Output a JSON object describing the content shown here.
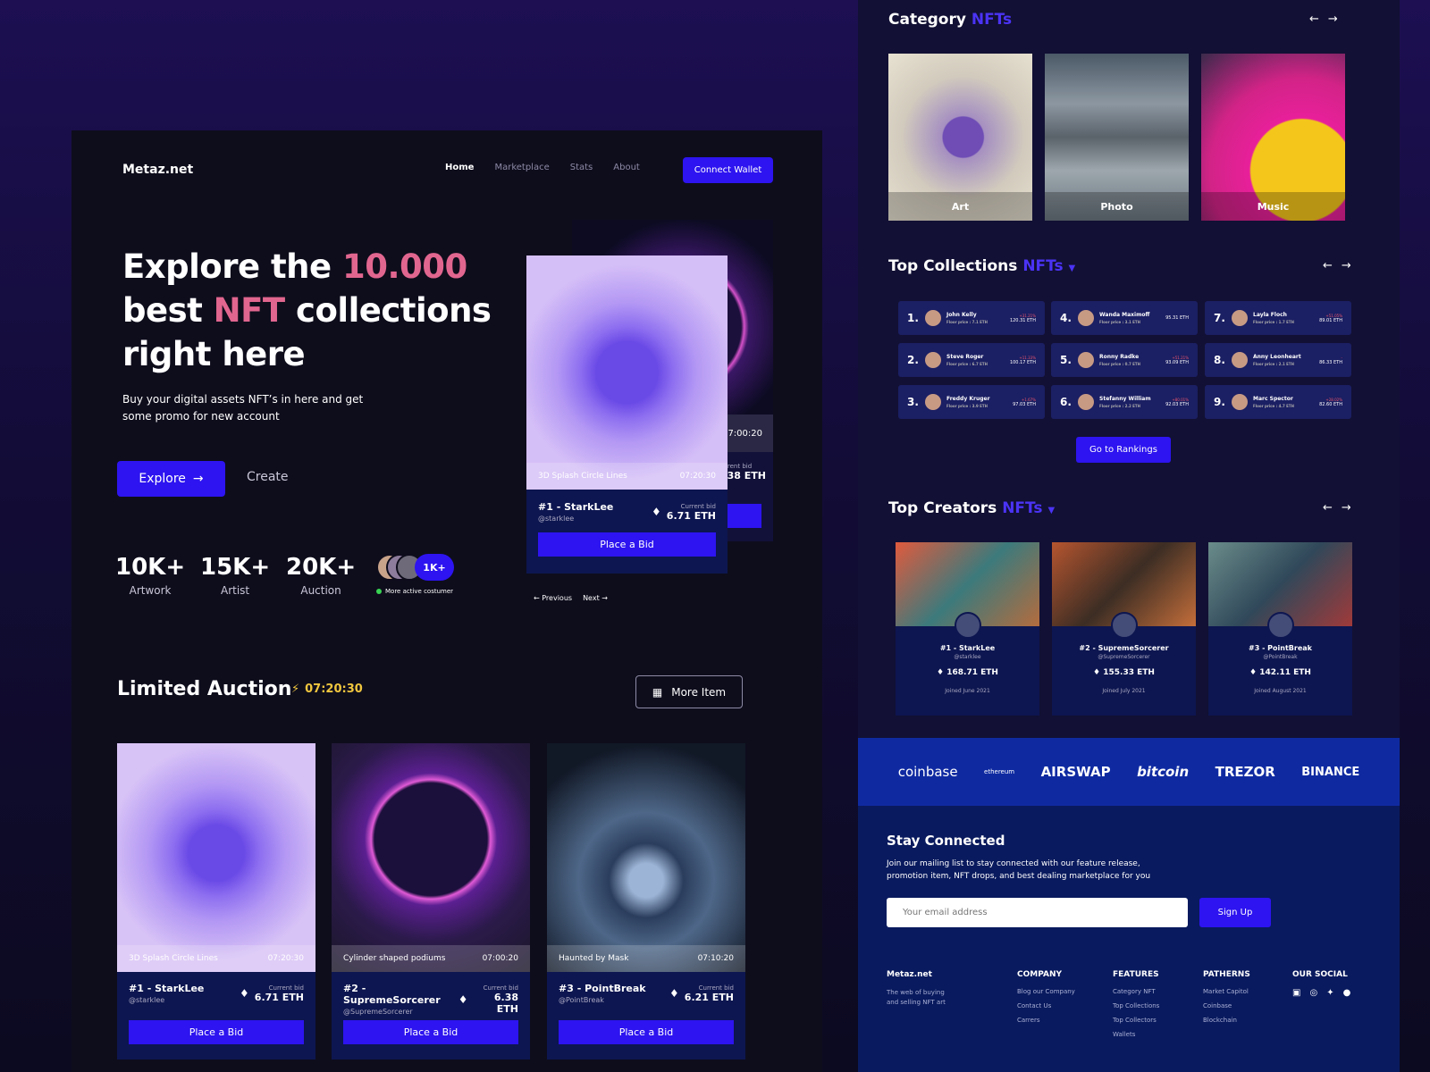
{
  "header": {
    "logo": "Metaz.net",
    "nav": [
      "Home",
      "Marketplace",
      "Stats",
      "About"
    ],
    "connect_label": "Connect Wallet"
  },
  "hero": {
    "title_pre": "Explore the ",
    "title_hl1": "10.000",
    "title_mid": "best ",
    "title_hl2": "NFT",
    "title_post": " collections right here",
    "subtitle": "Buy your digital assets NFT’s in here and get some promo for new account",
    "explore_label": "Explore",
    "create_label": "Create",
    "stats": [
      {
        "num": "10K+",
        "label": "Artwork"
      },
      {
        "num": "15K+",
        "label": "Artist"
      },
      {
        "num": "20K+",
        "label": "Auction"
      }
    ],
    "avatar_badge": "1K+",
    "active_label": "More active costumer",
    "back_card": {
      "timer": "07:00:20",
      "bid_label": "Current bid",
      "bid_value": "6.38 ETH"
    },
    "front_card": {
      "name": "3D Splash Circle Lines",
      "timer": "07:20:30",
      "title": "#1 - StarkLee",
      "handle": "@starklee",
      "bid_label": "Current bid",
      "bid_value": "6.71 ETH",
      "button": "Place a Bid"
    },
    "prev_label": "Previous",
    "next_label": "Next"
  },
  "auction": {
    "title": "Limited Auction",
    "timer": "07:20:30",
    "more_label": "More Item",
    "items": [
      {
        "name": "3D Splash Circle Lines",
        "timer": "07:20:30",
        "title": "#1 - StarkLee",
        "handle": "@starklee",
        "bid_label": "Current bid",
        "bid_value": "6.71 ETH",
        "button": "Place a Bid"
      },
      {
        "name": "Cylinder shaped podiums",
        "timer": "07:00:20",
        "title": "#2 - SupremeSorcerer",
        "handle": "@SupremeSorcerer",
        "bid_label": "Current bid",
        "bid_value": "6.38 ETH",
        "button": "Place a Bid"
      },
      {
        "name": "Haunted by Mask",
        "timer": "07:10:20",
        "title": "#3 - PointBreak",
        "handle": "@PointBreak",
        "bid_label": "Current bid",
        "bid_value": "6.21 ETH",
        "button": "Place a Bid"
      }
    ]
  },
  "category": {
    "title": "Category",
    "accent": "NFTs",
    "items": [
      "Art",
      "Photo",
      "Music"
    ]
  },
  "top_collections": {
    "title": "Top Collections",
    "accent": "NFTs",
    "button": "Go to Rankings",
    "items": [
      {
        "rank": "1.",
        "name": "John Kelly",
        "floor": "Floor price : 7.1 ETH",
        "value": "120.31 ETH",
        "change": "+31.21%"
      },
      {
        "rank": "4.",
        "name": "Wanda Maximoff",
        "floor": "Floor price : 3.1 ETH",
        "value": "95.31 ETH",
        "change": ""
      },
      {
        "rank": "7.",
        "name": "Layla Floch",
        "floor": "Floor price : 1.7 ETH",
        "value": "89.01 ETH",
        "change": "+51.05%"
      },
      {
        "rank": "2.",
        "name": "Steve Roger",
        "floor": "Floor price : 6.7 ETH",
        "value": "100.17 ETH",
        "change": "+11.33%"
      },
      {
        "rank": "5.",
        "name": "Ronny Radke",
        "floor": "Floor price : 0.7 ETH",
        "value": "93.09 ETH",
        "change": "+51.21%"
      },
      {
        "rank": "8.",
        "name": "Anny Leonheart",
        "floor": "Floor price : 2.1 ETH",
        "value": "86.33 ETH",
        "change": "-"
      },
      {
        "rank": "3.",
        "name": "Freddy Kruger",
        "floor": "Floor price : 3.9 ETH",
        "value": "97.03 ETH",
        "change": "+1.67%"
      },
      {
        "rank": "6.",
        "name": "Stefanny William",
        "floor": "Floor price : 2.2 ETH",
        "value": "92.03 ETH",
        "change": "+80.01%"
      },
      {
        "rank": "9.",
        "name": "Marc Spector",
        "floor": "Floor price : 4.7 ETH",
        "value": "82.60 ETH",
        "change": "+28.02%"
      }
    ]
  },
  "top_creators": {
    "title": "Top Creators",
    "accent": "NFTs",
    "items": [
      {
        "name": "#1 - StarkLee",
        "handle": "@starklee",
        "value": "168.71 ETH",
        "joined": "Joined June 2021"
      },
      {
        "name": "#2 - SupremeSorcerer",
        "handle": "@SupremeSorcerer",
        "value": "155.33 ETH",
        "joined": "Joined July 2021"
      },
      {
        "name": "#3 - PointBreak",
        "handle": "@PointBreak",
        "value": "142.11 ETH",
        "joined": "Joined August 2021"
      }
    ]
  },
  "brands": [
    "coinbase",
    "ethereum",
    "AIRSWAP",
    "bitcoin",
    "TREZOR",
    "BINANCE"
  ],
  "newsletter": {
    "title": "Stay Connected",
    "subtitle": "Join our mailing list to stay connected with our feature release, promotion item, NFT drops, and best dealing marketplace for you",
    "placeholder": "Your email address",
    "button": "Sign Up"
  },
  "footer": {
    "brand": "Metaz.net",
    "tagline": "The web of buying and selling NFT art",
    "company": {
      "title": "COMPANY",
      "items": [
        "Blog our Company",
        "Contact Us",
        "Carrers"
      ]
    },
    "features": {
      "title": "FEATURES",
      "items": [
        "Category NFT",
        "Top Collections",
        "Top Collectors",
        "Wallets"
      ]
    },
    "patherns": {
      "title": "PATHERNS",
      "items": [
        "Market Capitol",
        "Coinbase",
        "Blockchain"
      ]
    },
    "social": {
      "title": "OUR SOCIAL"
    }
  },
  "colors": {
    "primary": "#2d14f0",
    "highlight": "#e1668f",
    "timer": "#f0c63e"
  }
}
